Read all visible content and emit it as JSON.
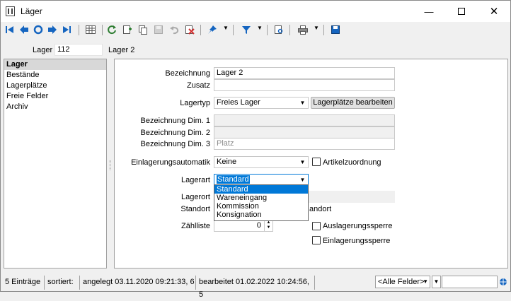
{
  "window": {
    "title": "Läger"
  },
  "header": {
    "lager_label": "Lager",
    "lager_number": "112",
    "lager_name": "Lager 2"
  },
  "nav": {
    "items": [
      {
        "label": "Lager",
        "selected": true
      },
      {
        "label": "Bestände"
      },
      {
        "label": "Lagerplätze"
      },
      {
        "label": "Freie Felder"
      },
      {
        "label": "Archiv"
      }
    ]
  },
  "form": {
    "bezeichnung_label": "Bezeichnung",
    "bezeichnung_value": "Lager 2",
    "zusatz_label": "Zusatz",
    "zusatz_value": "",
    "lagertyp_label": "Lagertyp",
    "lagertyp_value": "Freies Lager",
    "lagerplaetze_button": "Lagerplätze bearbeiten",
    "dim1_label": "Bezeichnung Dim. 1",
    "dim2_label": "Bezeichnung Dim. 2",
    "dim3_label": "Bezeichnung Dim. 3",
    "dim3_placeholder": "Platz",
    "einlagerungsautomatik_label": "Einlagerungsautomatik",
    "einlagerungsautomatik_value": "Keine",
    "artikelzuordnung_label": "Artikelzuordnung",
    "lagerart_label": "Lagerart",
    "lagerart_value": "Standard",
    "lagerart_options": [
      "Standard",
      "Wareneingang",
      "Kommission",
      "Konsignation"
    ],
    "lagerort_label": "Lagerort",
    "standort_label": "Standort",
    "standort_suffix": "andort",
    "zaehlliste_label": "Zählliste",
    "zaehlliste_value": "0",
    "auslagerungssperre_label": "Auslagerungssperre",
    "einlagerungssperre_label": "Einlagerungssperre"
  },
  "status": {
    "count": "5 Einträge",
    "sorted": "sortiert:",
    "created": "angelegt 03.11.2020 09:21:33,  6",
    "edited": "bearbeitet 01.02.2022 10:24:56,  5",
    "field_filter": "<Alle Felder>"
  },
  "colors": {
    "accent": "#0078d7",
    "icon_blue": "#1565c0",
    "icon_green": "#2e7d32",
    "icon_red": "#d32f2f"
  }
}
